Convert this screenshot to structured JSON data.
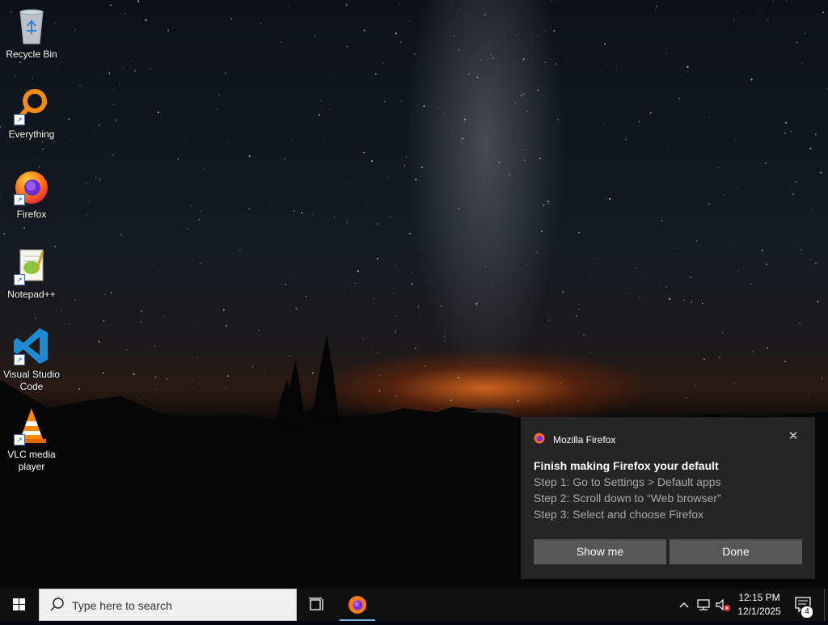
{
  "desktop": {
    "icons": [
      {
        "label": "Recycle Bin",
        "icon": "recycle-bin-icon"
      },
      {
        "label": "Everything",
        "icon": "everything-search-icon"
      },
      {
        "label": "Firefox",
        "icon": "firefox-icon"
      },
      {
        "label": "Notepad++",
        "icon": "notepad-plus-plus-icon"
      },
      {
        "label": "Visual Studio Code",
        "icon": "vscode-icon"
      },
      {
        "label": "VLC media player",
        "icon": "vlc-icon"
      }
    ]
  },
  "toast": {
    "app_name": "Mozilla Firefox",
    "title": "Finish making Firefox your default",
    "steps": [
      "Step 1: Go to Settings > Default apps",
      "Step 2: Scroll down to “Web browser”",
      "Step 3: Select and choose Firefox"
    ],
    "show_me_label": "Show me",
    "done_label": "Done",
    "close_symbol": "✕"
  },
  "taskbar": {
    "search_placeholder": "Type here to search",
    "time": "12:15 PM",
    "date": "12/1/2025",
    "notification_count": "4"
  },
  "colors": {
    "accent": "#76b9ed",
    "toast_bg": "#282828",
    "button_bg": "#575757",
    "taskbar_bg": "#101010"
  }
}
